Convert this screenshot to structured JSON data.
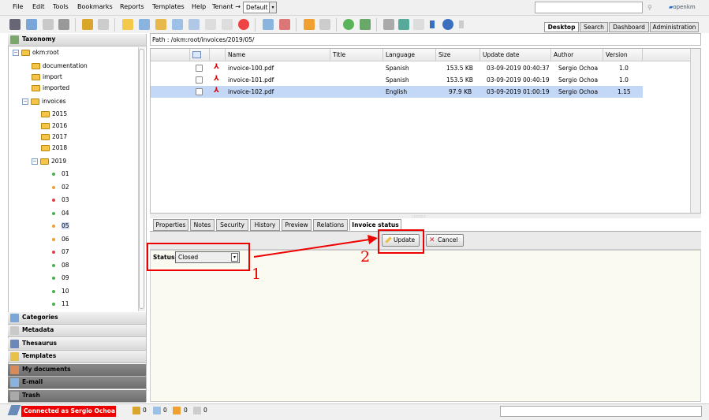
{
  "menu": {
    "items": [
      "File",
      "Edit",
      "Tools",
      "Bookmarks",
      "Reports",
      "Templates",
      "Help",
      "Tenant"
    ],
    "tenant_arrow": "→",
    "tenant_value": "Default"
  },
  "logo": {
    "text": "openkm"
  },
  "view_tabs": [
    {
      "label": "Desktop",
      "active": true
    },
    {
      "label": "Search",
      "active": false
    },
    {
      "label": "Dashboard",
      "active": false
    },
    {
      "label": "Administration",
      "active": false
    }
  ],
  "left": {
    "taxonomy_label": "Taxonomy",
    "tree": [
      {
        "label": "okm:root",
        "toggle": "⊟"
      },
      {
        "label": "documentation"
      },
      {
        "label": "import"
      },
      {
        "label": "imported"
      },
      {
        "label": "invoices",
        "toggle": "⊟"
      },
      {
        "label": "2015"
      },
      {
        "label": "2016"
      },
      {
        "label": "2017"
      },
      {
        "label": "2018"
      },
      {
        "label": "2019",
        "toggle": "⊟"
      },
      {
        "label": "01",
        "dot": "#4caf50"
      },
      {
        "label": "02",
        "dot": "#f0a030"
      },
      {
        "label": "03",
        "dot": "#e04040"
      },
      {
        "label": "04",
        "dot": "#4caf50"
      },
      {
        "label": "05",
        "dot": "#f0a030",
        "selected": true
      },
      {
        "label": "06",
        "dot": "#f0a030"
      },
      {
        "label": "07",
        "dot": "#e04040"
      },
      {
        "label": "08",
        "dot": "#4caf50"
      },
      {
        "label": "09",
        "dot": "#4caf50"
      },
      {
        "label": "10",
        "dot": "#4caf50"
      },
      {
        "label": "11",
        "dot": "#4caf50"
      }
    ],
    "stacks": [
      {
        "label": "Categories",
        "style": "light"
      },
      {
        "label": "Metadata",
        "style": "light"
      },
      {
        "label": "Thesaurus",
        "style": "light"
      },
      {
        "label": "Templates",
        "style": "light"
      },
      {
        "label": "My documents",
        "style": "dark"
      },
      {
        "label": "E-mail",
        "style": "dark"
      },
      {
        "label": "Trash",
        "style": "dark"
      }
    ]
  },
  "path": "Path : /okm:root/invoices/2019/05/",
  "table": {
    "columns": [
      "Name",
      "Title",
      "Language",
      "Size",
      "Update date",
      "Author",
      "Version"
    ],
    "rows": [
      {
        "name": "invoice-100.pdf",
        "title": "",
        "language": "Spanish",
        "size": "153.5 KB",
        "date": "03-09-2019 00:40:37",
        "author": "Sergio Ochoa",
        "version": "1.0",
        "selected": false
      },
      {
        "name": "invoice-101.pdf",
        "title": "",
        "language": "Spanish",
        "size": "153.5 KB",
        "date": "03-09-2019 00:40:19",
        "author": "Sergio Ochoa",
        "version": "1.0",
        "selected": false
      },
      {
        "name": "invoice-102.pdf",
        "title": "",
        "language": "English",
        "size": "97.9 KB",
        "date": "03-09-2019 01:00:19",
        "author": "Sergio Ochoa",
        "version": "1.15",
        "selected": true
      }
    ]
  },
  "prop_tabs": [
    {
      "label": "Properties"
    },
    {
      "label": "Notes"
    },
    {
      "label": "Security"
    },
    {
      "label": "History"
    },
    {
      "label": "Preview"
    },
    {
      "label": "Relations"
    },
    {
      "label": "Invoice status",
      "active": true
    }
  ],
  "form": {
    "update_label": "Update",
    "cancel_label": "Cancel",
    "status_label": "Status",
    "status_value": "Closed"
  },
  "annotations": {
    "one": "1",
    "two": "2",
    "color": "#e00000"
  },
  "statusbar": {
    "connected": "Connected as Sergio Ochoa",
    "counts": [
      "0",
      "0",
      "0",
      "0"
    ]
  }
}
